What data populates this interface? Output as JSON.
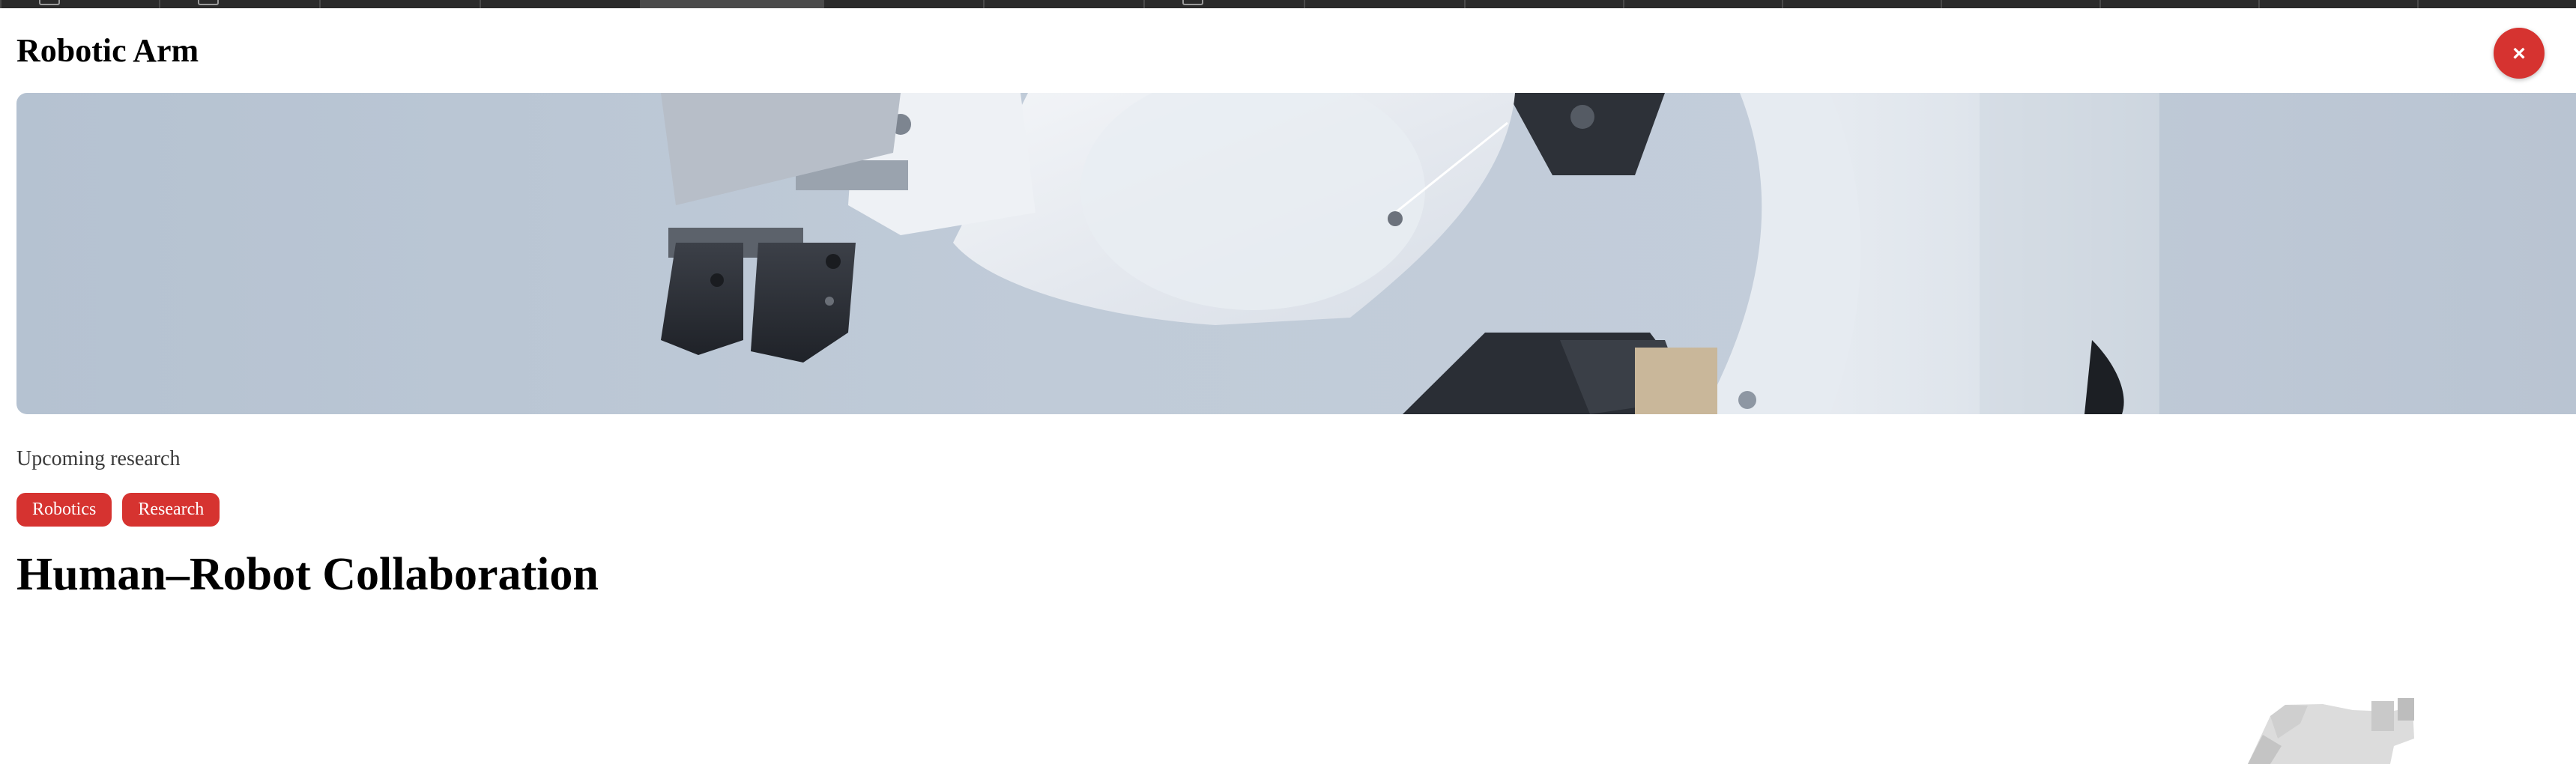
{
  "window": {
    "tab_count": 16,
    "active_tab_index": 4
  },
  "header": {
    "title": "Robotic Arm",
    "close_label": "×"
  },
  "hero": {
    "image": "robotic-arm-gripper-photo"
  },
  "content": {
    "subtitle": "Upcoming research",
    "tags": [
      "Robotics",
      "Research"
    ],
    "headline": "Human–Robot Collaboration"
  },
  "colors": {
    "accent": "#d63330",
    "hero_bg": "#c0cbd8",
    "topbar": "#2b2b2b"
  }
}
